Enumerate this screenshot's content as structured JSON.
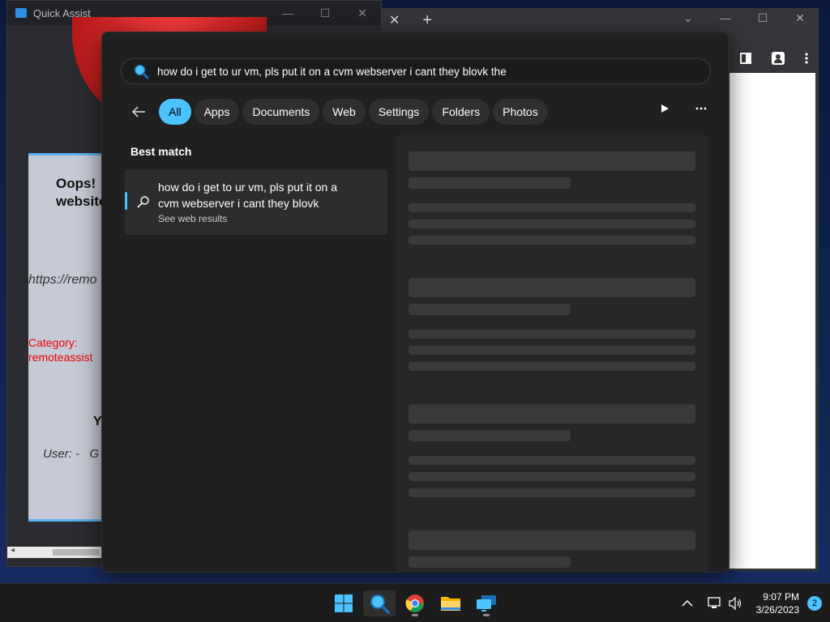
{
  "quick_assist": {
    "title": "Quick Assist",
    "oops_text": "Oops!\nwebsite",
    "url_text": "https://remo",
    "category_text": "Category:\nremoteassist",
    "y_text": "Y",
    "user_text": "User: -   G"
  },
  "search": {
    "query": "how do i get to ur vm, pls put it on a cvm webserver i cant they blovk the ",
    "filters": [
      "All",
      "Apps",
      "Documents",
      "Web",
      "Settings",
      "Folders",
      "Photos"
    ],
    "active_filter": "All",
    "best_match_label": "Best match",
    "result_title": "how do i get to ur vm, pls put it on a cvm webserver i cant they blovk",
    "result_subtitle": "See web results"
  },
  "taskbar": {
    "time": "9:07 PM",
    "date": "3/26/2023",
    "notification_count": "2",
    "pinned": [
      "start-icon",
      "search-icon",
      "chrome-icon",
      "file-explorer-icon",
      "quick-assist-icon"
    ]
  },
  "colors": {
    "accent": "#4cc2ff",
    "panel_bg": "#202020",
    "chip_bg": "#2f2f2f"
  }
}
